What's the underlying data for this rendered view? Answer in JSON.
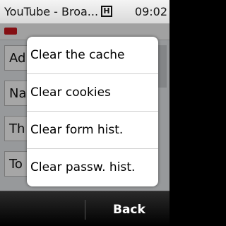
{
  "status_bar": {
    "title": "YouTube - Broa...",
    "indicator": "H",
    "time": "09:02"
  },
  "background_page": {
    "rows": [
      "Ad",
      "Na",
      "Th",
      "To"
    ]
  },
  "menu": {
    "items": [
      {
        "label": "Clear the cache"
      },
      {
        "label": "Clear cookies"
      },
      {
        "label": "Clear form hist."
      },
      {
        "label": "Clear passw. hist."
      }
    ]
  },
  "softkeys": {
    "right_label": "Back"
  }
}
